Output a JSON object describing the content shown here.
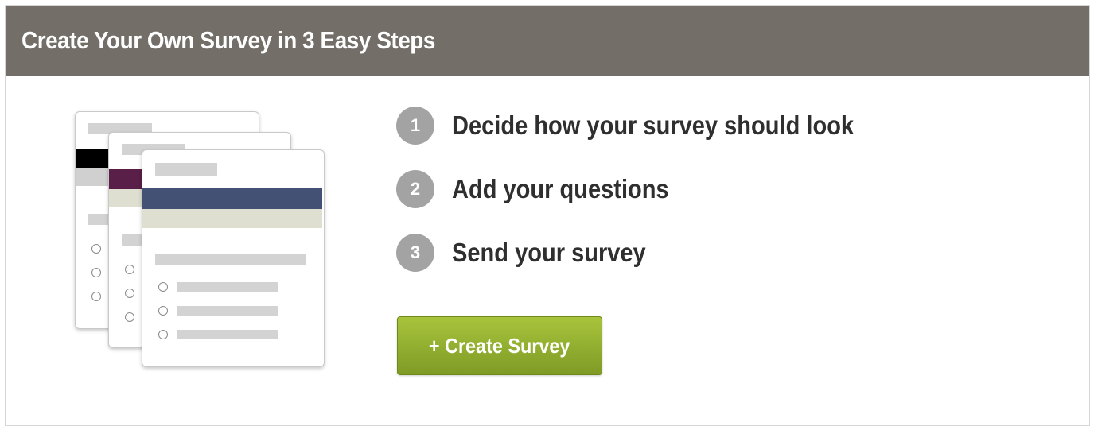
{
  "header": {
    "title": "Create Your Own Survey in 3 Easy Steps"
  },
  "illustration": {
    "name": "survey-cards-illustration",
    "accent_colors": [
      "#000000",
      "#5a1f49",
      "#435274"
    ]
  },
  "steps": [
    {
      "number": "1",
      "text": "Decide how your survey should look"
    },
    {
      "number": "2",
      "text": "Add your questions"
    },
    {
      "number": "3",
      "text": "Send your survey"
    }
  ],
  "actions": {
    "create_label": "+ Create Survey"
  },
  "colors": {
    "header_bg": "#736f68",
    "button": "#94b031",
    "step_badge": "#a3a3a3"
  }
}
